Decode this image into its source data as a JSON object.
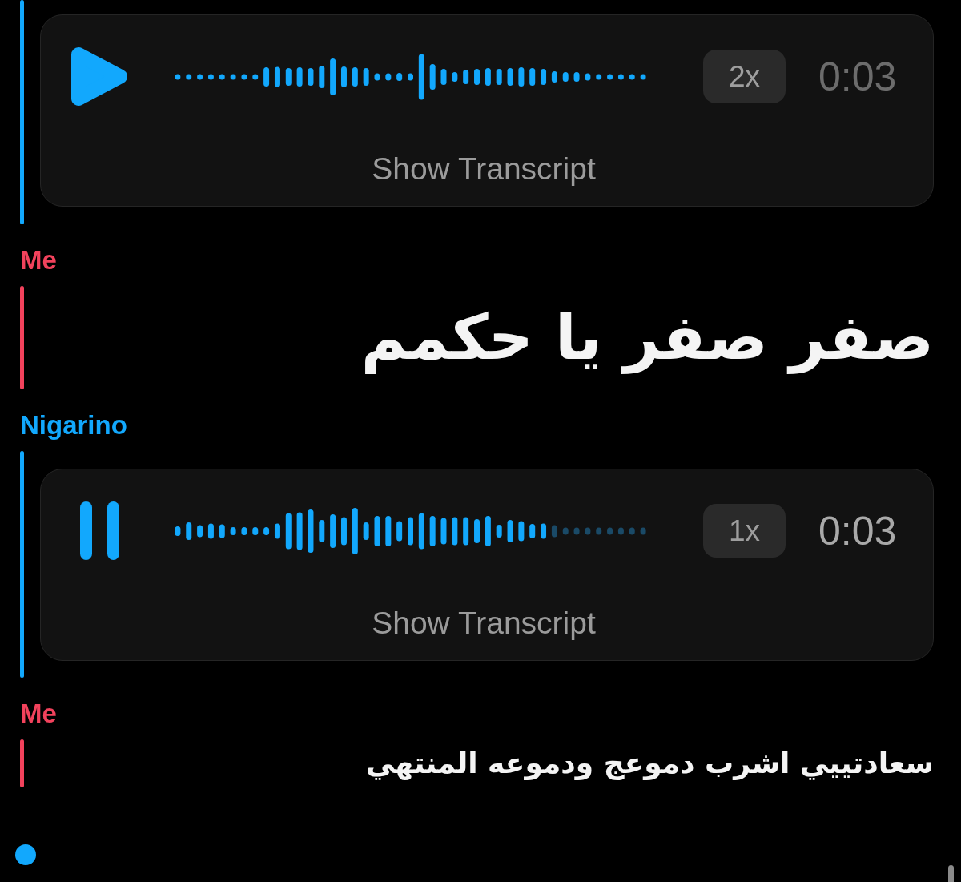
{
  "conversation": {
    "messages": [
      {
        "kind": "voice",
        "color": "#12a8fd",
        "playing": false,
        "speed": "2x",
        "duration": "0:03",
        "transcript_button": "Show Transcript"
      },
      {
        "kind": "big_text",
        "sender": "Me",
        "color": "#f2425c",
        "text": "صفر صفر يا حكمم"
      },
      {
        "kind": "voice",
        "sender": "Nigarino",
        "color": "#12a8fd",
        "playing": true,
        "level": 0.8,
        "speed": "1x",
        "duration": "0:03",
        "transcript_button": "Show Transcript"
      },
      {
        "kind": "text",
        "sender": "Me",
        "color": "#f2425c",
        "text": "سعادتييي اشرب دموعج ودموعه المنتهي"
      }
    ]
  }
}
